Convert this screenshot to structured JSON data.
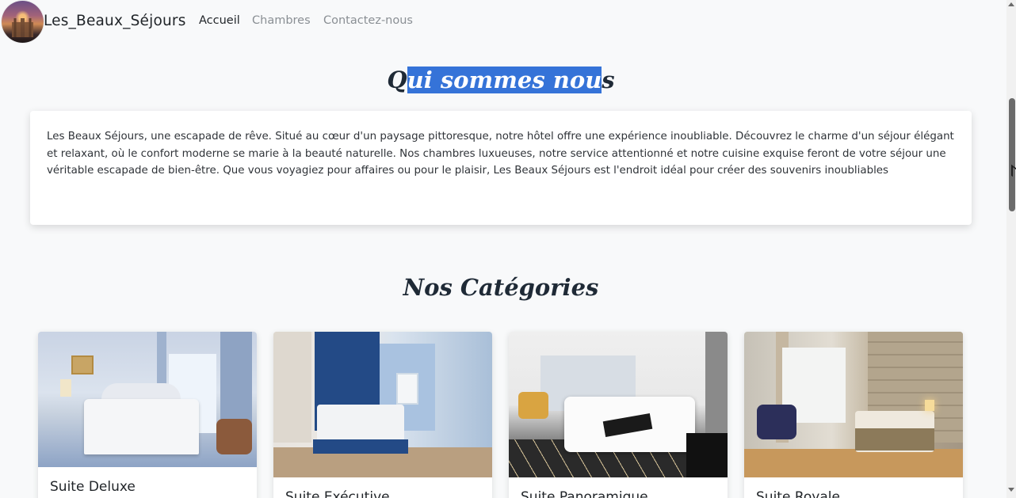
{
  "navbar": {
    "brand": "Les_Beaux_Séjours",
    "links": [
      {
        "label": "Accueil",
        "active": true
      },
      {
        "label": "Chambres",
        "active": false
      },
      {
        "label": "Contactez-nous",
        "active": false
      }
    ]
  },
  "about": {
    "title_prefix": "Q",
    "title_selected": "ui sommes nou",
    "title_suffix": "s",
    "text": "Les Beaux Séjours, une escapade de rêve. Situé au cœur d'un paysage pittoresque, notre hôtel offre une expérience inoubliable. Découvrez le charme d'un séjour élégant et relaxant, où le confort moderne se marie à la beauté naturelle. Nos chambres luxueuses, notre service attentionné et notre cuisine exquise feront de votre séjour une véritable escapade de bien-être. Que vous voyagiez pour affaires ou pour le plaisir, Les Beaux Séjours est l'endroit idéal pour créer des souvenirs inoubliables"
  },
  "categories": {
    "title": "Nos Catégories",
    "cards": [
      {
        "title": "Suite Deluxe",
        "image": "room-photo-deluxe"
      },
      {
        "title": "Suite Exécutive",
        "image": "room-photo-executive"
      },
      {
        "title": "Suite Panoramique",
        "image": "room-photo-panoramic"
      },
      {
        "title": "Suite Royale",
        "image": "room-photo-royale"
      }
    ]
  },
  "colors": {
    "background": "#f8f9fa",
    "selection": "#3573d8",
    "title": "#1f2a36",
    "nav_inactive": "#8a8f94"
  }
}
